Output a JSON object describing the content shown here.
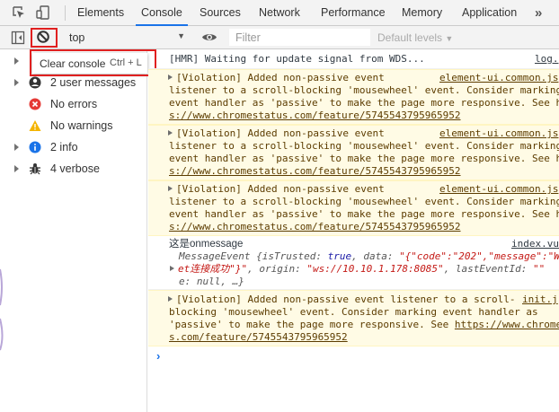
{
  "tabs": [
    "Elements",
    "Console",
    "Sources",
    "Network",
    "Performance",
    "Memory",
    "Application"
  ],
  "more_tabs_glyph": "»",
  "toolbar": {
    "context": "top",
    "filter_placeholder": "Filter",
    "levels": "Default levels"
  },
  "tooltip": {
    "label": "Clear console",
    "shortcut": "Ctrl + L"
  },
  "sidebar": [
    {
      "label": "2 user messages",
      "icon": "user-icon"
    },
    {
      "label": "No errors",
      "icon": "error-icon"
    },
    {
      "label": "No warnings",
      "icon": "warning-icon"
    },
    {
      "label": "2 info",
      "icon": "info-icon"
    },
    {
      "label": "4 verbose",
      "icon": "bug-icon"
    }
  ],
  "messages": {
    "hmr": {
      "text": "[HMR] Waiting for update signal from WDS...",
      "source": "log."
    },
    "violation": {
      "l1": "[Violation] Added non-passive event ",
      "l2": "listener to a scroll-blocking 'mousewheel' event. Consider marking",
      "l3": "event handler as 'passive' to make the page more responsive. See h",
      "l4": "s://www.chromestatus.com/feature/5745543795965952",
      "source": "element-ui.common.js"
    },
    "onmessage": {
      "head": "这是onmessage",
      "source": "index.vu",
      "obj1": "MessageEvent {isTrusted: ",
      "obj_true": "true",
      "obj2": ", data: ",
      "obj_data1": "\"{\"code\":\"202\",\"message\":\"W",
      "obj_data2": "et连接成功\"}\"",
      "obj3": ", origin: ",
      "obj_origin": "\"ws://10.10.1.178:8085\"",
      "obj4": ", lastEventId: ",
      "obj_lei": "\"\"",
      "obj5": "e: null, …}"
    },
    "violation_last": {
      "l1": "[Violation] Added non-passive event listener to a scroll-",
      "l2": "blocking 'mousewheel' event. Consider marking event handler as",
      "l3a": "'passive' to make the page more responsive. See ",
      "l3b": "https://www.chrome",
      "l4": "s.com/feature/5745543795965952",
      "source": "init.j"
    }
  },
  "prompt_glyph": "›"
}
